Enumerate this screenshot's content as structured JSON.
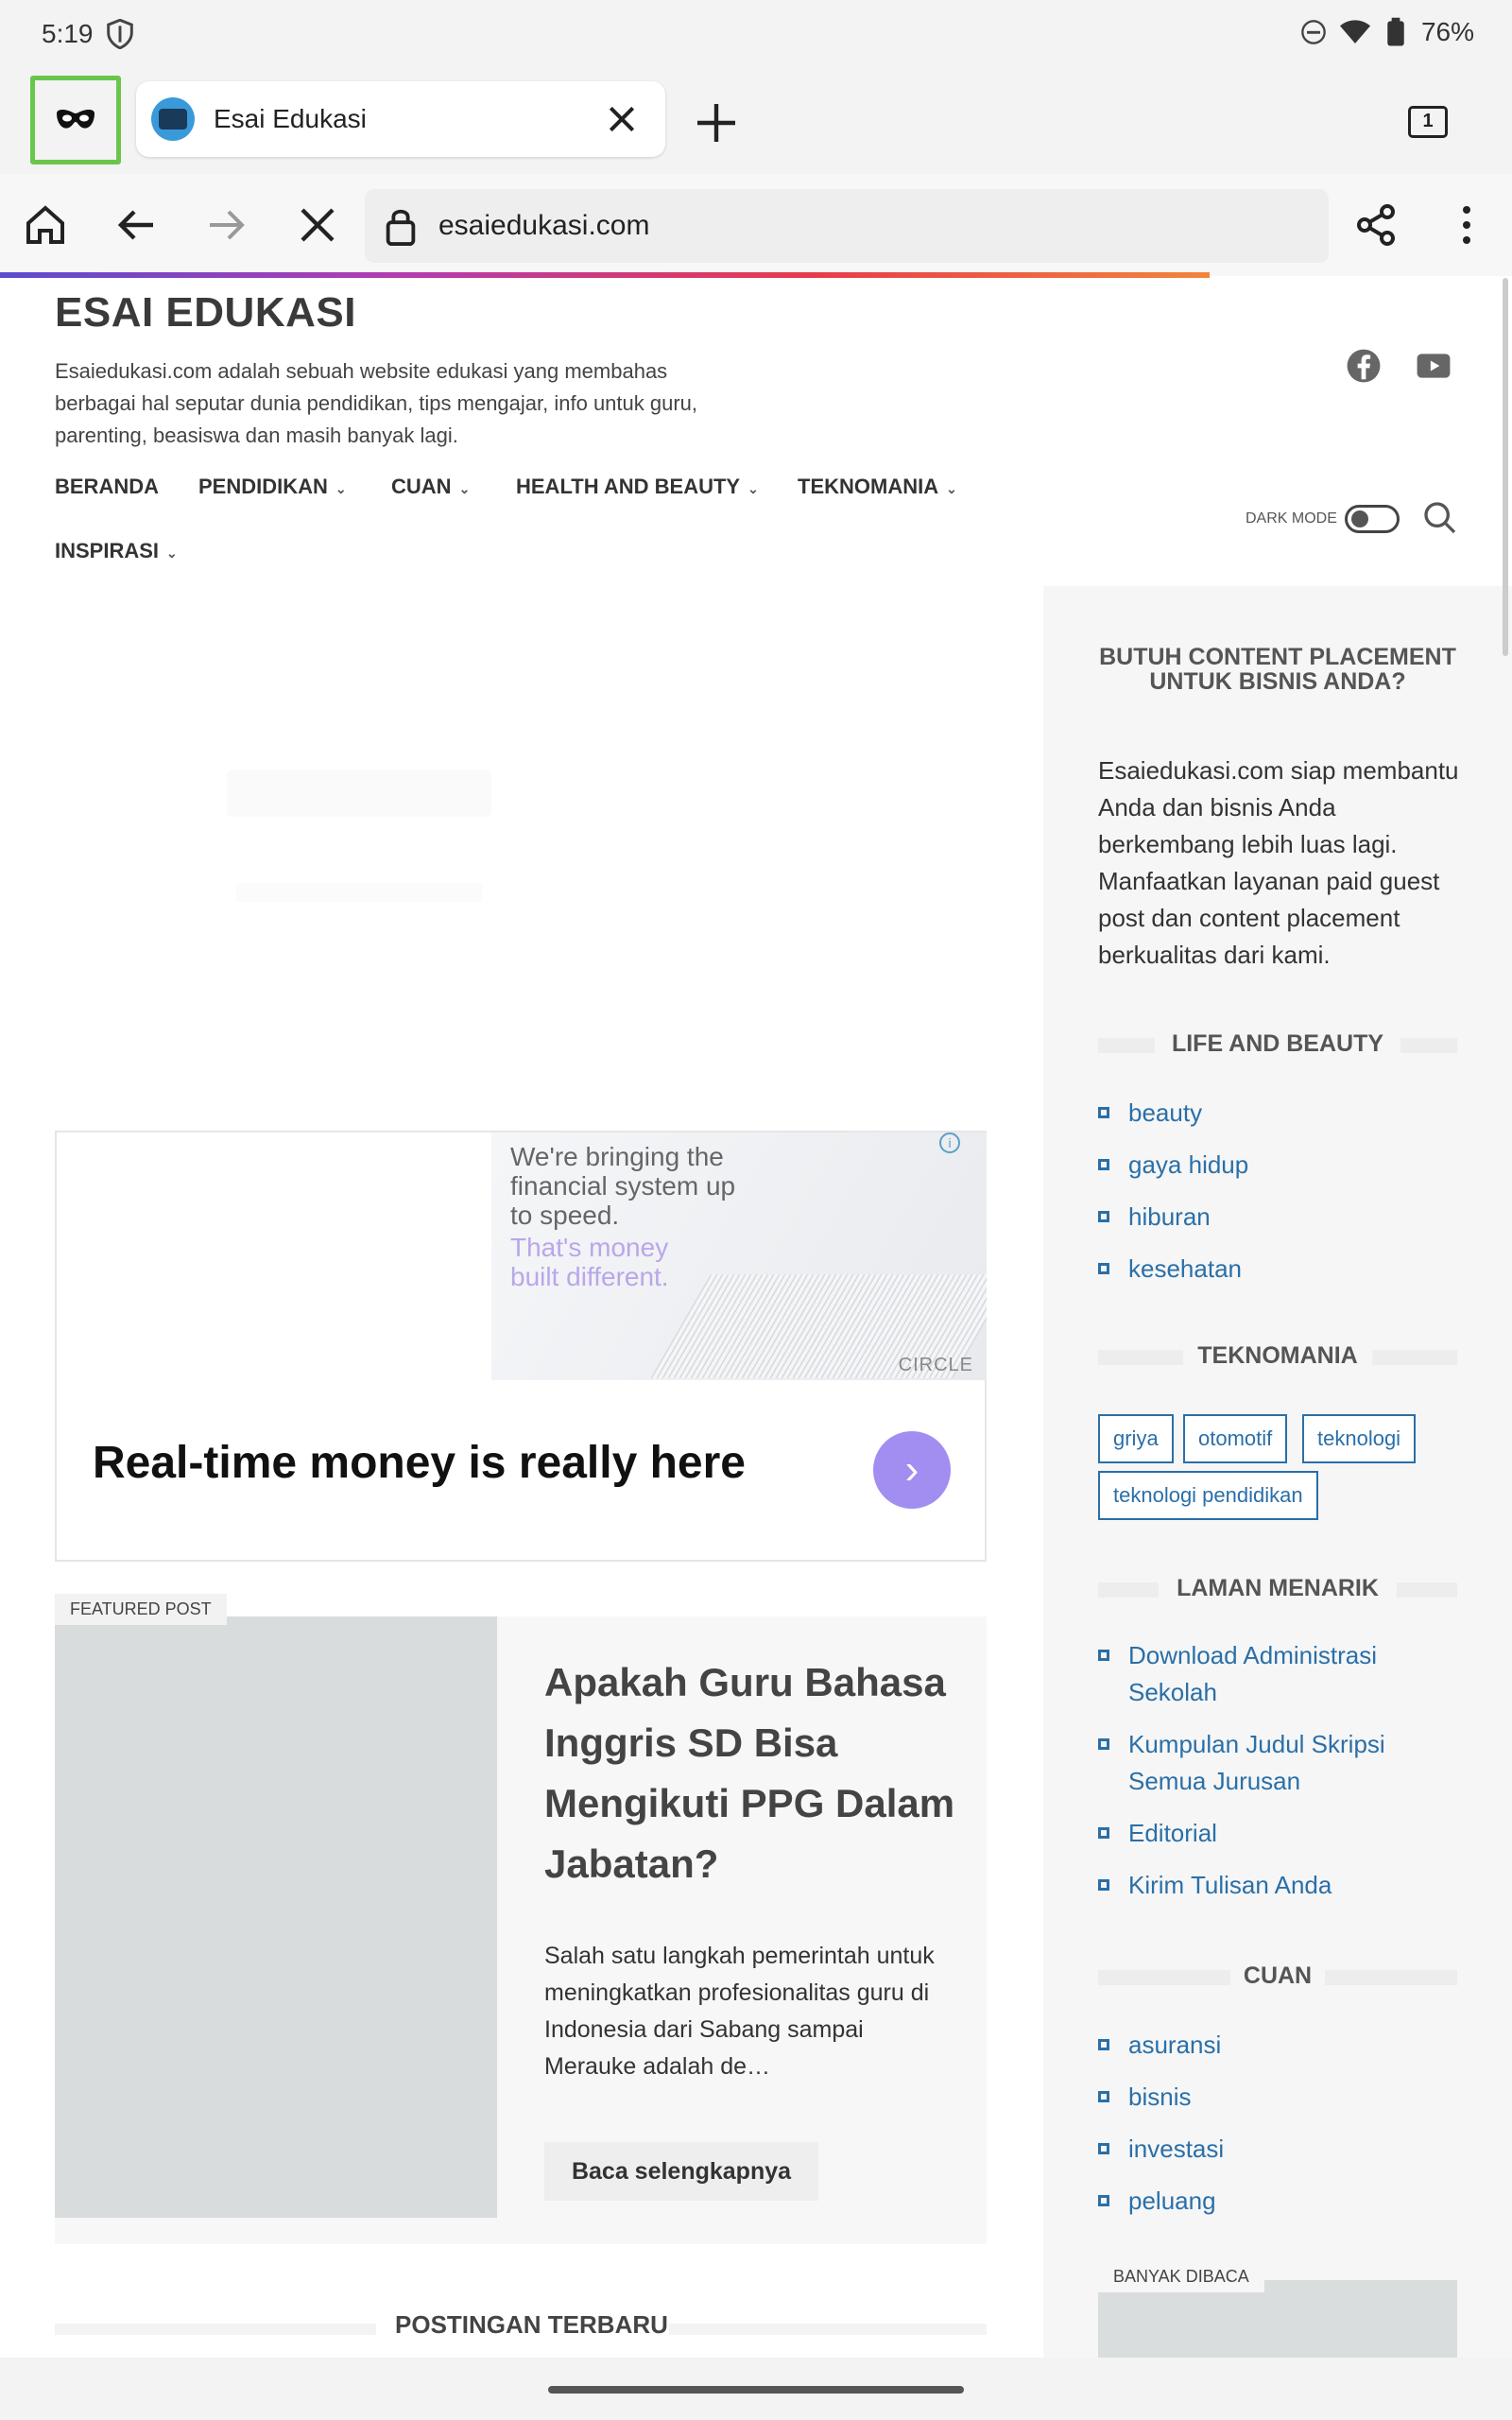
{
  "status": {
    "time": "5:19",
    "battery": "76%"
  },
  "tabs": {
    "active_title": "Esai Edukasi",
    "count": "1"
  },
  "toolbar": {
    "url": "esaiedukasi.com"
  },
  "site": {
    "title": "ESAI EDUKASI",
    "description": "Esaiedukasi.com adalah sebuah website edukasi yang membahas berbagai hal seputar dunia pendidikan, tips mengajar, info untuk guru, parenting, beasiswa dan masih banyak lagi."
  },
  "nav": {
    "items": [
      "BERANDA",
      "PENDIDIKAN",
      "CUAN",
      "HEALTH AND BEAUTY",
      "TEKNOMANIA",
      "INSPIRASI"
    ],
    "dark_mode_label": "DARK MODE"
  },
  "ad": {
    "line1": "We're bringing the financial system up to speed.",
    "line2": "That's money built different.",
    "brand": "CIRCLE",
    "headline": "Real-time money is really here"
  },
  "featured": {
    "badge": "FEATURED POST",
    "title": "Apakah Guru Bahasa Inggris SD Bisa Mengikuti PPG Dalam Jabatan?",
    "excerpt": "Salah satu langkah pemerintah untuk meningkatkan profesionalitas guru di Indonesia dari Sabang sampai Merauke adalah de…",
    "read_more": "Baca selengkapnya"
  },
  "latest_label": "POSTINGAN TERBARU",
  "sidebar": {
    "promo_title": "BUTUH CONTENT PLACEMENT UNTUK BISNIS ANDA?",
    "promo_text": "Esaiedukasi.com siap membantu Anda dan bisnis Anda berkembang lebih luas lagi. Manfaatkan layanan paid guest post dan content placement berkualitas dari kami.",
    "life": {
      "label": "LIFE AND BEAUTY",
      "links": [
        "beauty",
        "gaya hidup",
        "hiburan",
        "kesehatan"
      ]
    },
    "tekno": {
      "label": "TEKNOMANIA",
      "tags": [
        "griya",
        "otomotif",
        "teknologi",
        "teknologi pendidikan"
      ]
    },
    "laman": {
      "label": "LAMAN MENARIK",
      "links": [
        "Download Administrasi Sekolah",
        "Kumpulan Judul Skripsi Semua Jurusan",
        "Editorial",
        "Kirim Tulisan Anda"
      ]
    },
    "cuan": {
      "label": "CUAN",
      "links": [
        "asuransi",
        "bisnis",
        "investasi",
        "peluang"
      ]
    },
    "banyak_dibaca": "BANYAK DIBACA"
  },
  "colors": {
    "link": "#2a6fa8",
    "incognito_highlight": "#6ac64a",
    "ad_button": "#a18ef0"
  }
}
